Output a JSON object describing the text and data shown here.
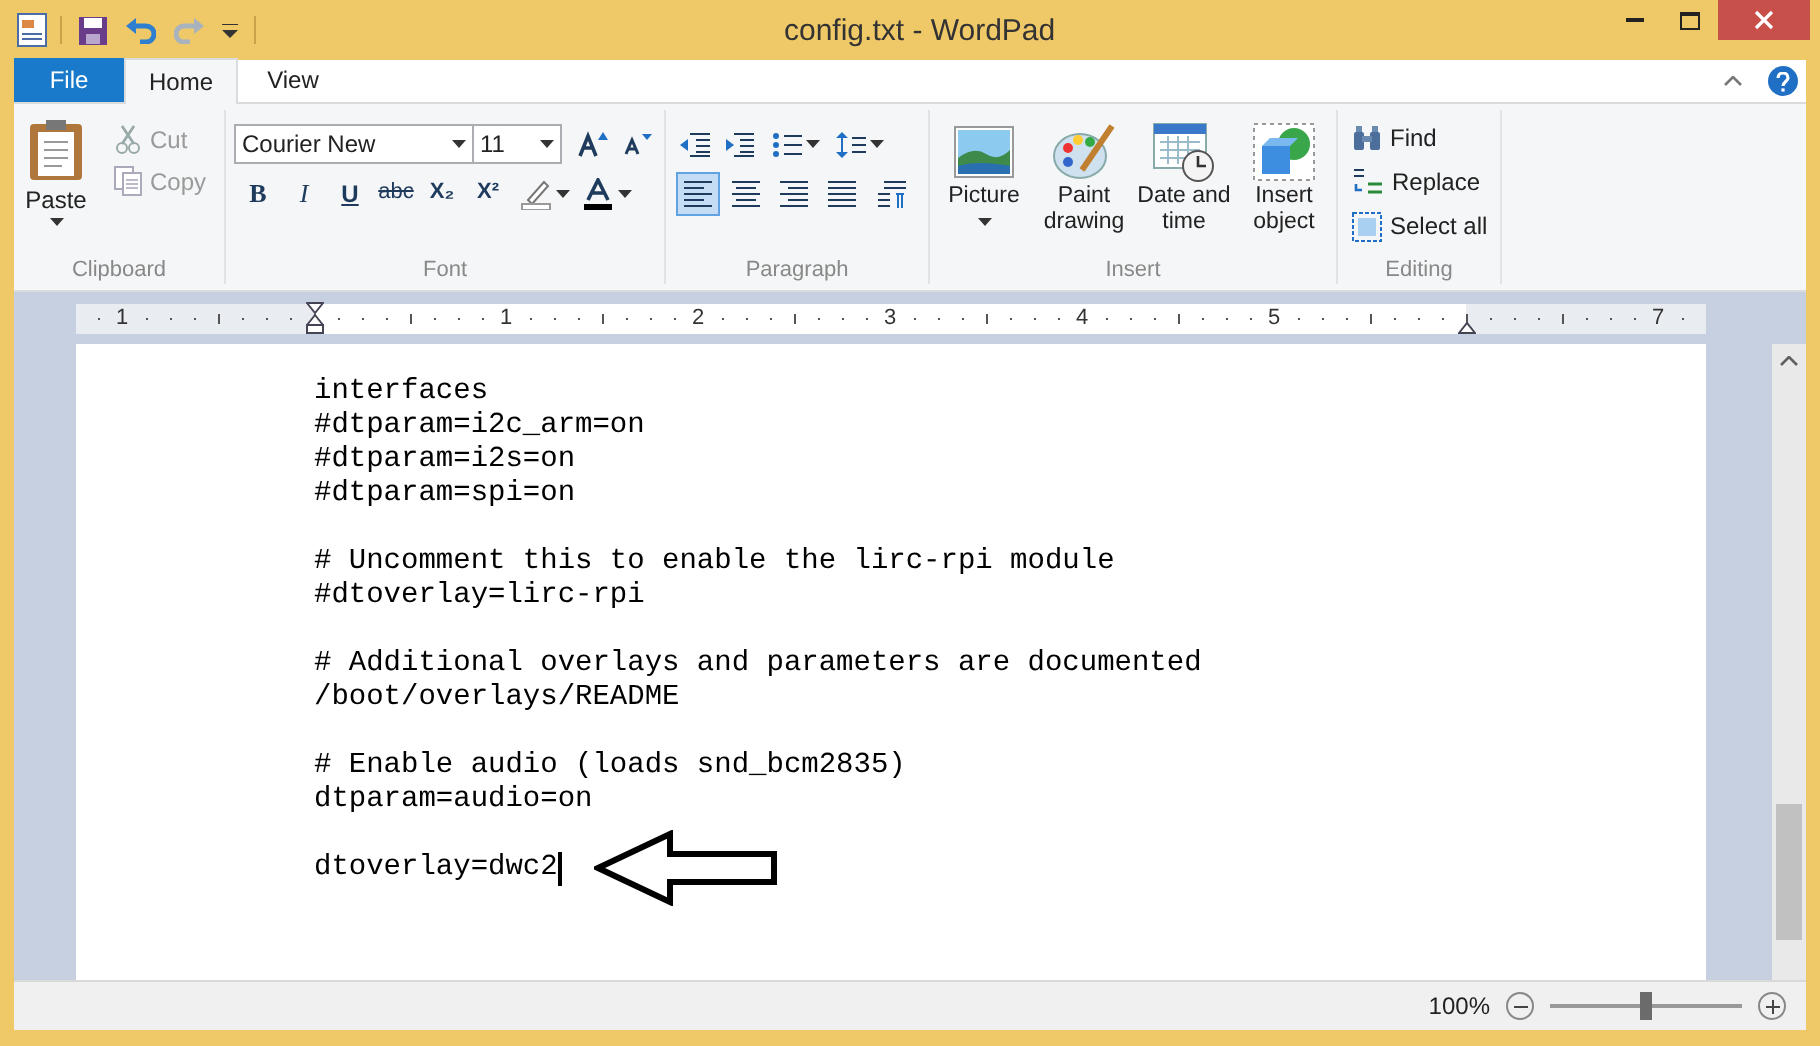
{
  "window": {
    "title": "config.txt - WordPad"
  },
  "ribbon_tabs": [
    {
      "label": "File",
      "kind": "file",
      "selected": false
    },
    {
      "label": "Home",
      "kind": "tab",
      "selected": true
    },
    {
      "label": "View",
      "kind": "tab",
      "selected": false
    }
  ],
  "clipboard": {
    "label": "Clipboard",
    "paste": "Paste",
    "items": [
      {
        "label": "Cut",
        "kind": "cut",
        "disabled": true
      },
      {
        "label": "Copy",
        "kind": "copy",
        "disabled": true
      }
    ]
  },
  "font": {
    "label": "Font",
    "family": "Courier New",
    "size": "11",
    "format_buttons": [
      {
        "label": "B",
        "kind": "bold"
      },
      {
        "label": "I",
        "kind": "italic"
      },
      {
        "label": "U",
        "kind": "underline"
      },
      {
        "label": "abc",
        "kind": "strike"
      },
      {
        "label": "X₂",
        "kind": "sub"
      },
      {
        "label": "X²",
        "kind": "sup"
      }
    ]
  },
  "paragraph": {
    "label": "Paragraph",
    "alignment": [
      {
        "kind": "left",
        "selected": true
      },
      {
        "kind": "center",
        "selected": false
      },
      {
        "kind": "right",
        "selected": false
      },
      {
        "kind": "justify",
        "selected": false
      }
    ]
  },
  "insert": {
    "label": "Insert",
    "items": [
      {
        "label": "Picture",
        "kind": "picture",
        "dropdown": true
      },
      {
        "label": "Paint drawing",
        "kind": "paint",
        "dropdown": false
      },
      {
        "label": "Date and time",
        "kind": "datetime",
        "dropdown": false
      },
      {
        "label": "Insert object",
        "kind": "object",
        "dropdown": false
      }
    ]
  },
  "editing": {
    "label": "Editing",
    "items": [
      {
        "label": "Find",
        "kind": "find"
      },
      {
        "label": "Replace",
        "kind": "replace"
      },
      {
        "label": "Select all",
        "kind": "selectall"
      }
    ]
  },
  "ruler": {
    "labels": [
      "1",
      "1",
      "2",
      "3",
      "4",
      "5",
      "7"
    ]
  },
  "document": {
    "caret": true,
    "paragraphs": [
      [
        "interfaces",
        "#dtparam=i2c_arm=on",
        "#dtparam=i2s=on",
        "#dtparam=spi=on"
      ],
      [
        "# Uncomment this to enable the lirc-rpi module",
        "#dtoverlay=lirc-rpi"
      ],
      [
        "# Additional overlays and parameters are documented",
        "/boot/overlays/README"
      ],
      [
        "# Enable audio (loads snd_bcm2835)",
        "dtparam=audio=on"
      ],
      [
        "dtoverlay=dwc2"
      ]
    ]
  },
  "status_bar": {
    "zoom": "100%",
    "zoom_slider": {
      "level": 0.5
    }
  }
}
